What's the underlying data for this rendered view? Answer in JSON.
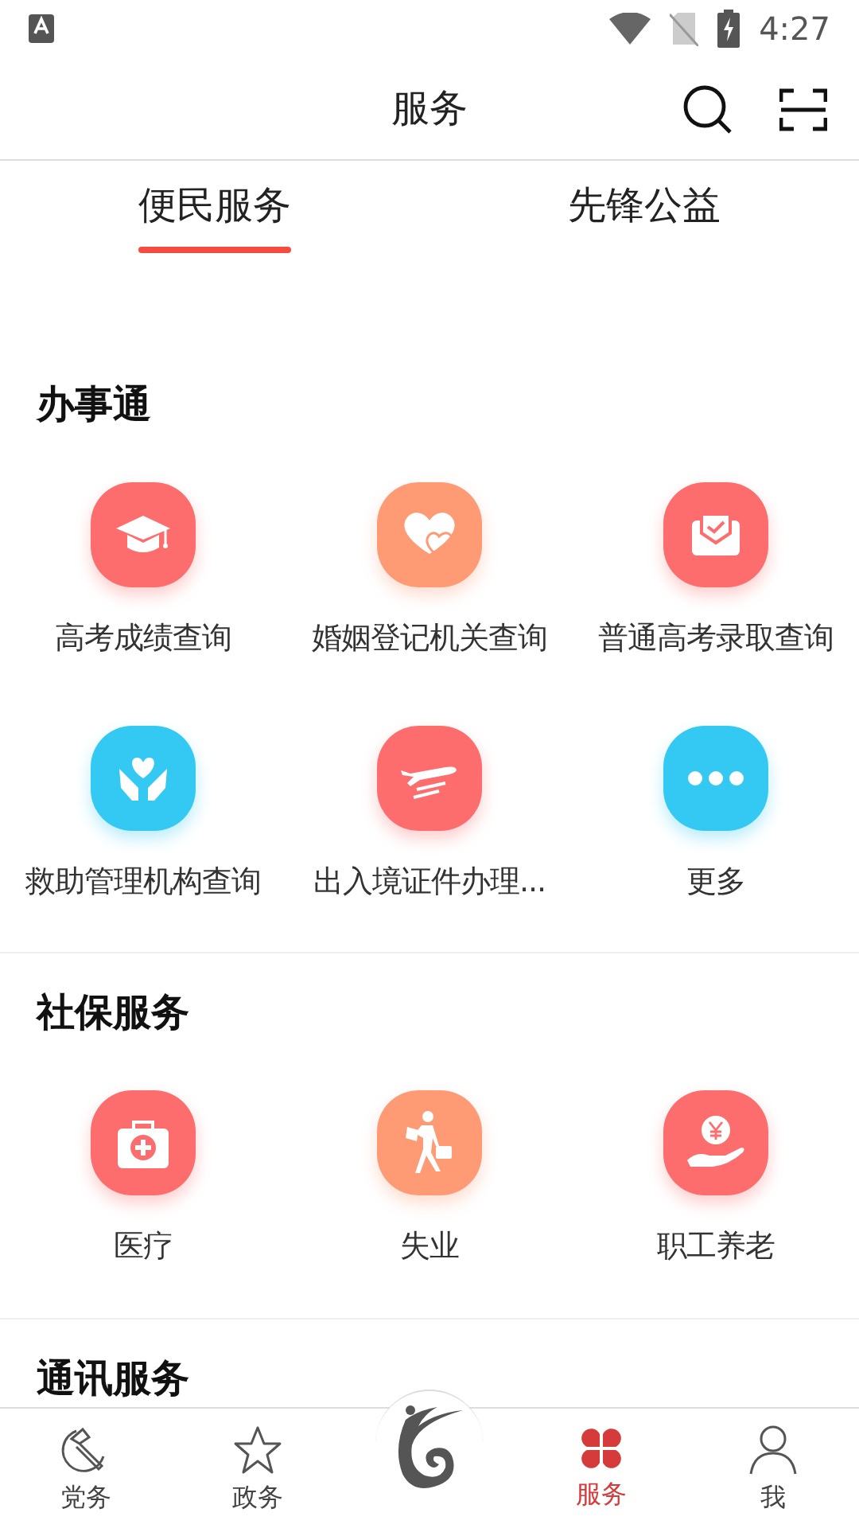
{
  "status_bar": {
    "time": "4:27"
  },
  "header": {
    "title": "服务"
  },
  "tabs": [
    {
      "label": "便民服务",
      "selected": true
    },
    {
      "label": "先锋公益",
      "selected": false
    }
  ],
  "sections": [
    {
      "title": "办事通",
      "items": [
        {
          "label": "高考成绩查询",
          "kind": "cap",
          "color": "#fe6d6d"
        },
        {
          "label": "婚姻登记机关查询",
          "kind": "hearts",
          "color": "#fe9a74"
        },
        {
          "label": "普通高考录取查询",
          "kind": "envelope",
          "color": "#fe6d6d"
        },
        {
          "label": "救助管理机构查询",
          "kind": "hands",
          "color": "#33c9f2"
        },
        {
          "label": "出入境证件办理...",
          "kind": "plane",
          "color": "#fe6d6d"
        },
        {
          "label": "更多",
          "kind": "more",
          "color": "#33c9f2"
        }
      ]
    },
    {
      "title": "社保服务",
      "items": [
        {
          "label": "医疗",
          "kind": "medkit",
          "color": "#fe6d6d"
        },
        {
          "label": "失业",
          "kind": "walker",
          "color": "#fe9a74"
        },
        {
          "label": "职工养老",
          "kind": "coin",
          "color": "#fe6d6d"
        }
      ]
    },
    {
      "title": "通讯服务"
    }
  ],
  "nav": [
    {
      "label": "党务",
      "kind": "emblem",
      "selected": false
    },
    {
      "label": "政务",
      "kind": "star",
      "selected": false
    },
    {
      "kind": "logo",
      "selected": false
    },
    {
      "label": "服务",
      "kind": "clover",
      "selected": true
    },
    {
      "label": "我",
      "kind": "person",
      "selected": false
    }
  ]
}
